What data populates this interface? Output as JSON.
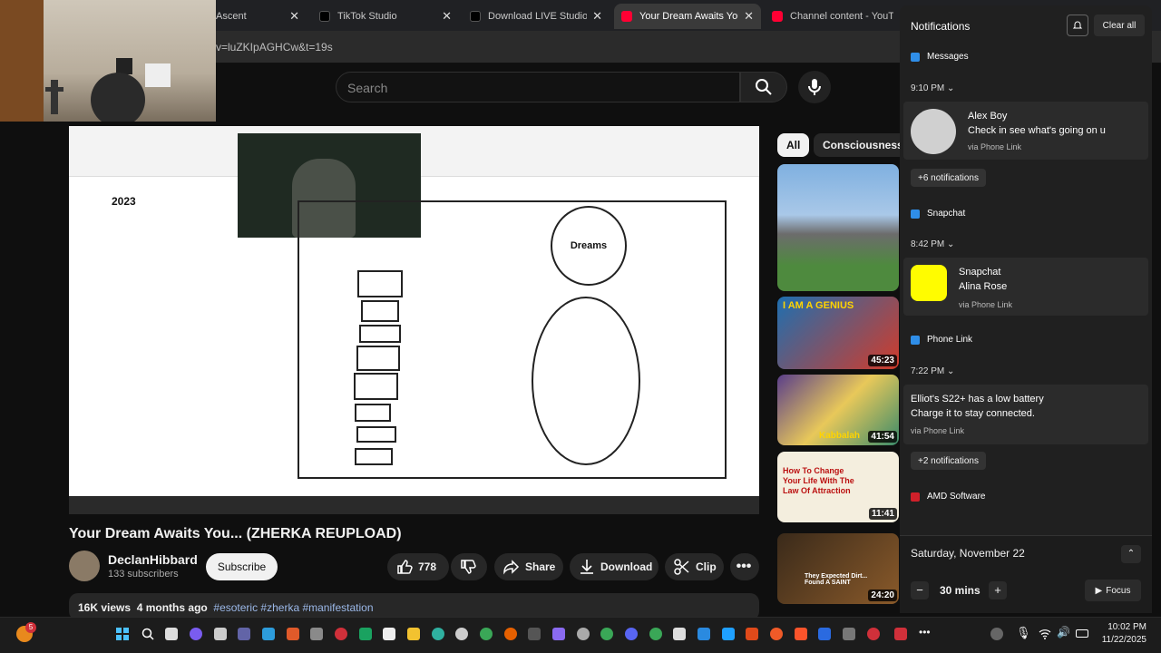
{
  "browser": {
    "tabs": [
      {
        "label": "Ascent",
        "active": false
      },
      {
        "label": "TikTok Studio",
        "active": false
      },
      {
        "label": "Download LIVE Studio |",
        "active": false
      },
      {
        "label": "Your Dream Awaits You.",
        "active": true
      },
      {
        "label": "Channel content - YouT",
        "active": false
      }
    ],
    "url_fragment": "v=luZKIpAGHCw&t=19s"
  },
  "youtube": {
    "search_placeholder": "Search",
    "video_inner": {
      "year_label": "2023",
      "dreams_label": "Dreams"
    },
    "video": {
      "title": "Your Dream Awaits You... (ZHERKA REUPLOAD)",
      "channel": "DeclanHibbard",
      "subscribers": "133 subscribers",
      "subscribe_label": "Subscribe",
      "likes": "778",
      "share_label": "Share",
      "download_label": "Download",
      "clip_label": "Clip",
      "views": "16K views",
      "age": "4 months ago",
      "tags": "#esoteric #zherka #manifestation"
    },
    "chips": [
      "All",
      "Consciousness"
    ],
    "recommendations": [
      {
        "duration": "",
        "caption": ""
      },
      {
        "duration": "45:23",
        "caption": "I AM A GENIUS"
      },
      {
        "duration": "41:54",
        "caption": "Kabbalah"
      },
      {
        "duration": "11:41",
        "caption": "How To Change Your Life With The Law Of Attraction"
      },
      {
        "duration": "24:20",
        "caption": "They Expected Dirt... Found A SAINT"
      }
    ]
  },
  "notifications": {
    "header": "Notifications",
    "clear_all": "Clear all",
    "groups": [
      {
        "app": "Messages",
        "time": "9:10 PM",
        "sender": "Alex Boy",
        "body": "Check in see what's going on u",
        "via": "via Phone Link",
        "more": "+6 notifications"
      },
      {
        "app": "Snapchat",
        "time": "8:42 PM",
        "sender": "Snapchat",
        "body": "Alina Rose",
        "via": "via Phone Link"
      },
      {
        "app": "Phone Link",
        "time": "7:22 PM",
        "sender": "Elliot's S22+ has a low battery",
        "body": "Charge it to stay connected.",
        "via": "via Phone Link",
        "more": "+2 notifications"
      },
      {
        "app": "AMD Software"
      }
    ],
    "calendar": {
      "date": "Saturday, November 22",
      "focus_minutes": "30 mins",
      "focus_label": "Focus"
    }
  },
  "taskbar": {
    "badge_count": "5",
    "time": "10:02 PM",
    "date": "11/22/2025"
  }
}
